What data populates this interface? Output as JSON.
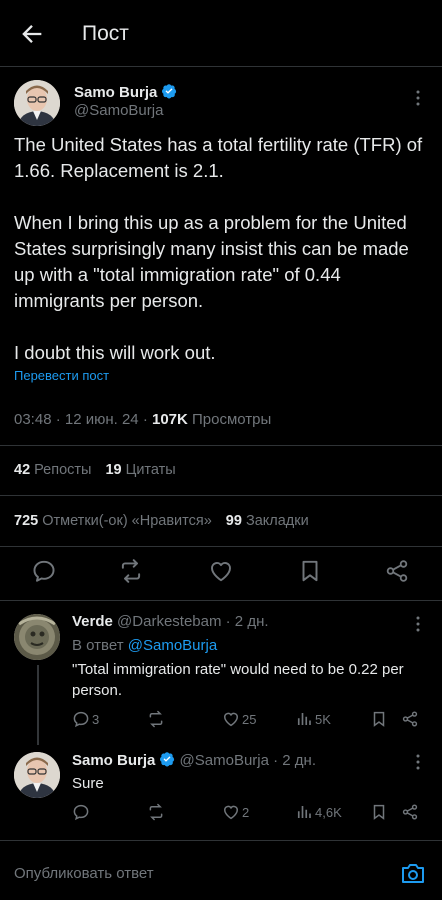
{
  "header": {
    "title": "Пост"
  },
  "post": {
    "author_name": "Samo Burja",
    "author_handle": "@SamoBurja",
    "paragraphs": [
      "The United States has a total fertility rate (TFR) of 1.66. Replacement is 2.1.",
      "When I bring this up as a problem for the United States surprisingly many insist this can be made up with a \"total immigration rate\" of 0.44 immigrants per person.",
      "I doubt this will work out."
    ],
    "translate_label": "Перевести пост",
    "timestamp": "03:48 · 12 июн. 24 · ",
    "views_count": "107K",
    "views_label": " Просмотры",
    "reposts_count": "42",
    "reposts_label": "Репосты",
    "quotes_count": "19",
    "quotes_label": "Цитаты",
    "likes_count": "725",
    "likes_label": "Отметки(-ок) «Нравится»",
    "bookmarks_count": "99",
    "bookmarks_label": "Закладки"
  },
  "replies": [
    {
      "author_name": "Verde",
      "author_handle": "@Darkestebam · 2 дн.",
      "in_reply_prefix": "В ответ ",
      "in_reply_handle": "@SamoBurja",
      "text": "\"Total immigration rate\" would need to be 0.22 per person.",
      "reply_count": "3",
      "repost_count": "",
      "like_count": "25",
      "views_count": "5K"
    },
    {
      "author_name": "Samo Burja",
      "author_handle": "@SamoBurja · 2 дн.",
      "text": "Sure",
      "reply_count": "",
      "repost_count": "",
      "like_count": "2",
      "views_count": "4,6K"
    }
  ],
  "composer": {
    "placeholder": "Опубликовать ответ"
  },
  "colors": {
    "accent": "#1d9bf0",
    "muted": "#71767b",
    "text": "#e7e9ea",
    "background": "#000000"
  },
  "icons": [
    "back-arrow-icon",
    "verified-badge-icon",
    "more-icon",
    "reply-icon",
    "repost-icon",
    "like-icon",
    "bookmark-icon",
    "share-icon",
    "views-icon",
    "camera-icon"
  ]
}
